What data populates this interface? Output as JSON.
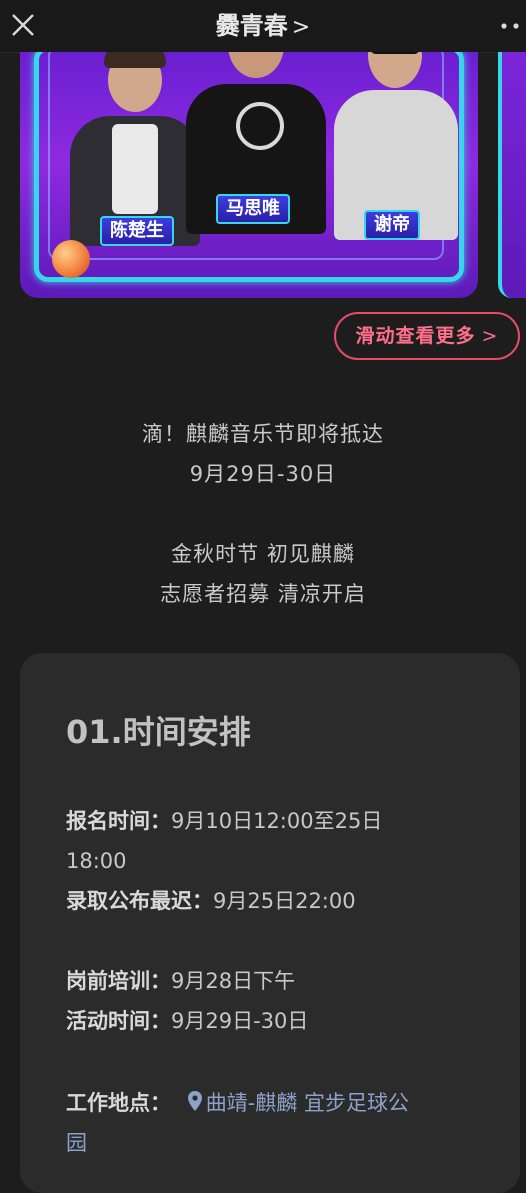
{
  "header": {
    "title": "爨青春",
    "chevron": ">",
    "close_icon": "close-icon",
    "more_icon": "more-dots-icon"
  },
  "banner": {
    "artists": [
      "陈楚生",
      "马思唯",
      "谢帝"
    ]
  },
  "scroll_more": {
    "label": "滑动查看更多",
    "arrow": ">"
  },
  "intro": {
    "line1": "滴！麒麟音乐节即将抵达",
    "line2": "9月29日-30日",
    "line3": "金秋时节 初见麒麟",
    "line4": "志愿者招募 清凉开启"
  },
  "schedule": {
    "title": "01.时间安排",
    "signup_label": "报名时间：",
    "signup_value_1": "9月10日12:00至25日",
    "signup_value_2": "18:00",
    "admit_label": "录取公布最迟：",
    "admit_value": "9月25日22:00",
    "training_label": "岗前培训：",
    "training_value": "9月28日下午",
    "event_label": "活动时间：",
    "event_value": "9月29日-30日",
    "location_label": "工作地点：",
    "location_value_1": "曲靖-麒麟 宜步足球公",
    "location_value_2": "园",
    "location_icon": "map-pin-icon"
  },
  "colors": {
    "background": "#1d1d1d",
    "card": "#2b2b2b",
    "accent_pink": "#ff6e8a",
    "location_blue": "#8da2c8"
  }
}
